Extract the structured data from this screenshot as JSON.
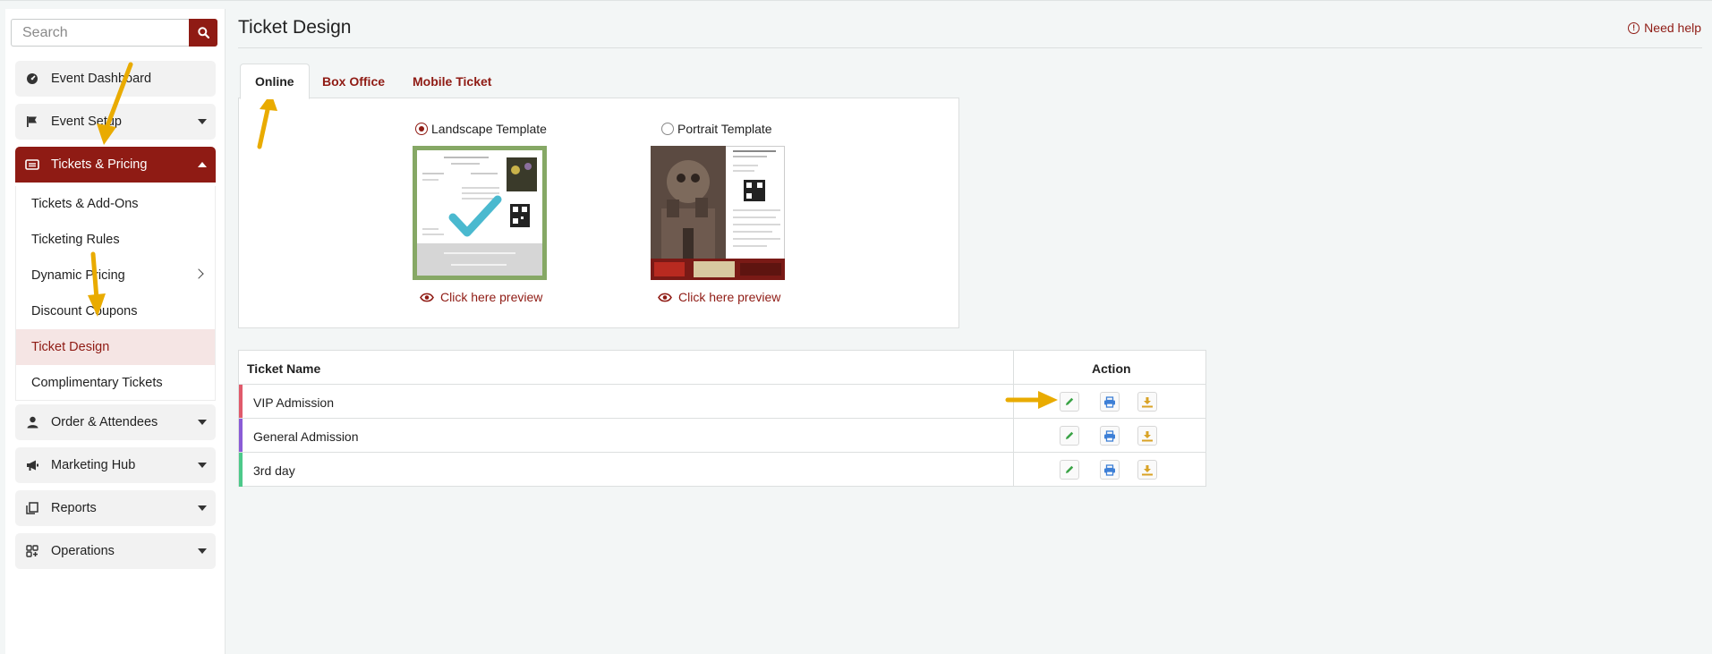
{
  "search": {
    "placeholder": "Search"
  },
  "sidebar": {
    "items": [
      {
        "label": "Event Dashboard"
      },
      {
        "label": "Event Setup"
      },
      {
        "label": "Tickets & Pricing"
      },
      {
        "label": "Order & Attendees"
      },
      {
        "label": "Marketing Hub"
      },
      {
        "label": "Reports"
      },
      {
        "label": "Operations"
      }
    ],
    "subitems": [
      {
        "label": "Tickets & Add-Ons"
      },
      {
        "label": "Ticketing Rules"
      },
      {
        "label": "Dynamic Pricing"
      },
      {
        "label": "Discount Coupons"
      },
      {
        "label": "Ticket Design"
      },
      {
        "label": "Complimentary Tickets"
      }
    ]
  },
  "main": {
    "title": "Ticket Design",
    "help": "Need help",
    "tabs": [
      {
        "label": "Online"
      },
      {
        "label": "Box Office"
      },
      {
        "label": "Mobile Ticket"
      }
    ],
    "templates": [
      {
        "label": "Landscape Template",
        "selected": true,
        "preview": "Click here preview"
      },
      {
        "label": "Portrait Template",
        "selected": false,
        "preview": "Click here preview"
      }
    ],
    "table": {
      "headers": {
        "name": "Ticket Name",
        "action": "Action"
      },
      "rows": [
        {
          "name": "VIP Admission",
          "color": "#e05a6b"
        },
        {
          "name": "General Admission",
          "color": "#8a5cd6"
        },
        {
          "name": "3rd day",
          "color": "#4cc98a"
        }
      ]
    }
  },
  "colors": {
    "brand": "#8f1b14",
    "edit": "#3aa346",
    "print": "#3d7fd6",
    "download": "#d9a326",
    "annotation_arrow": "#f2b300"
  },
  "icons": [
    "search-icon",
    "dashboard-icon",
    "flag-icon",
    "ticket-icon",
    "user-icon",
    "megaphone-icon",
    "reports-icon",
    "operations-icon",
    "info-icon",
    "eye-icon",
    "edit-icon",
    "print-icon",
    "download-icon"
  ]
}
